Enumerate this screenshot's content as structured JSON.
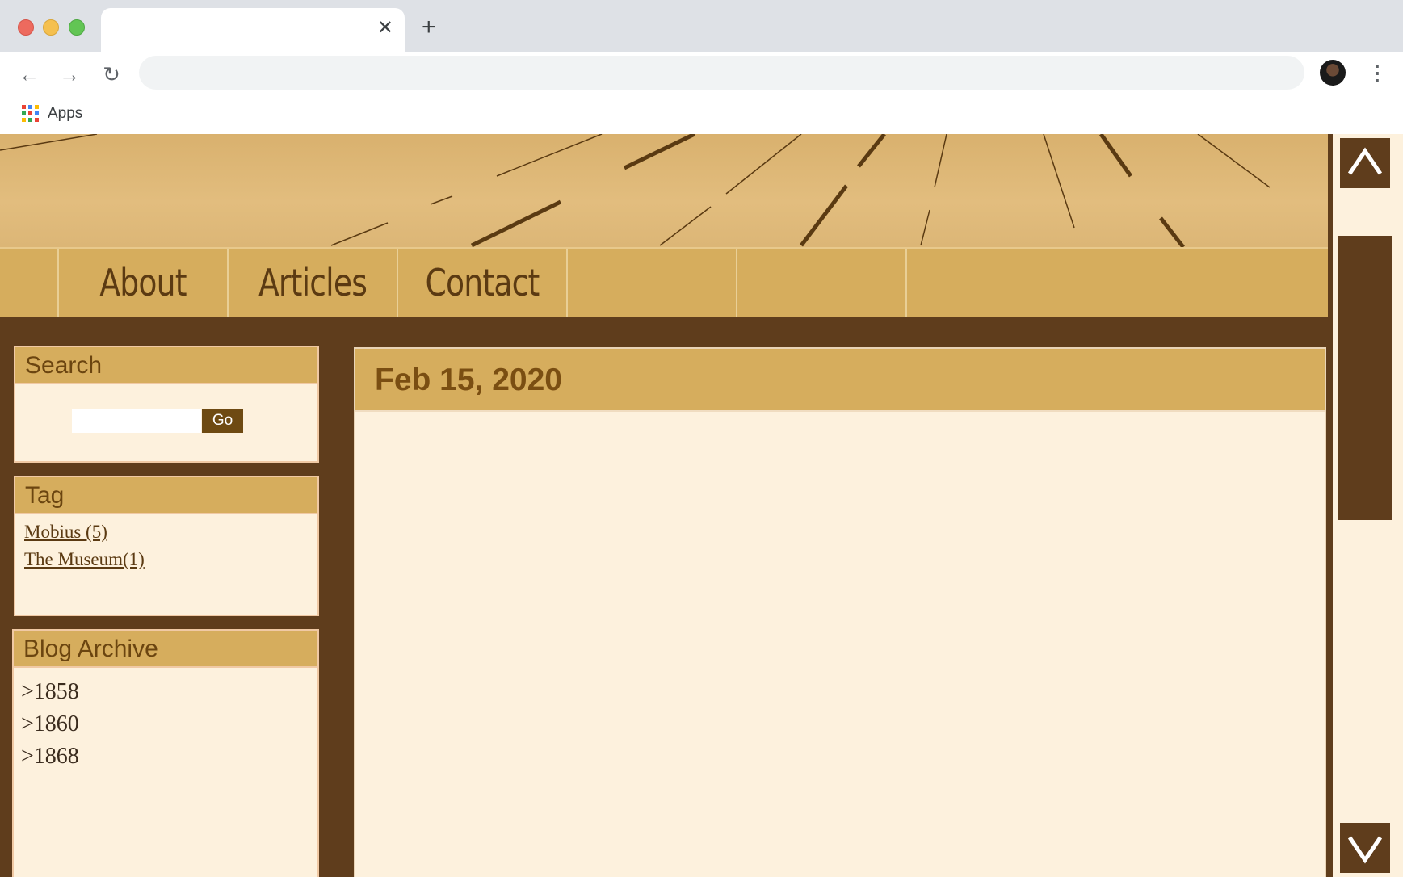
{
  "browser": {
    "tab_title": "",
    "tab_close_glyph": "✕",
    "new_tab_glyph": "+",
    "back_glyph": "←",
    "forward_glyph": "→",
    "reload_glyph": "↻",
    "menu_glyph": "⋮",
    "address": "",
    "bookmarks": [
      {
        "label": "Apps",
        "icon": "apps-grid-icon"
      }
    ]
  },
  "nav": {
    "items": [
      {
        "label": ""
      },
      {
        "label": "About"
      },
      {
        "label": "Articles"
      },
      {
        "label": "Contact"
      },
      {
        "label": ""
      },
      {
        "label": ""
      },
      {
        "label": ""
      }
    ]
  },
  "search": {
    "title": "Search",
    "input_value": "",
    "button_label": "Go"
  },
  "tags": {
    "title": "Tag",
    "items": [
      "Mobius (5)",
      "The Museum(1)"
    ]
  },
  "archive": {
    "title": "Blog Archive",
    "items": [
      ">1858",
      ">1860",
      ">1868"
    ]
  },
  "post": {
    "date": "Feb 15, 2020"
  },
  "colors": {
    "page_bg": "#5f3d1c",
    "nav_bg": "#d6ad5d",
    "panel_bg": "#fdf1dd",
    "accent_text": "#6b4510",
    "button_bg": "#6e4a12"
  }
}
